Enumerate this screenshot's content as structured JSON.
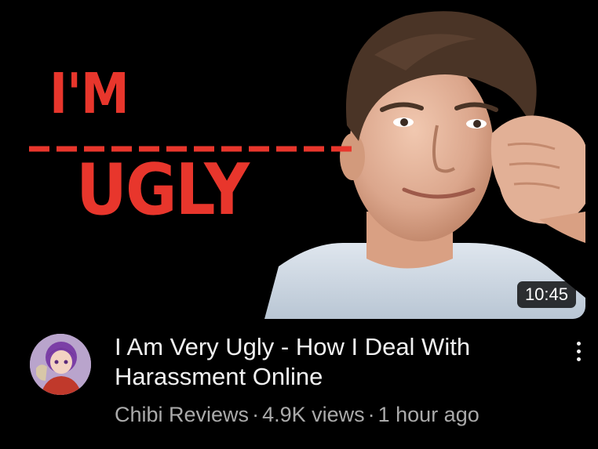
{
  "video": {
    "thumbnail": {
      "text_line1": "I'M",
      "text_line2": "UGLY",
      "accent_color": "#e8362c"
    },
    "duration": "10:45",
    "title": "I Am Very Ugly - How I Deal With Harassment Online",
    "channel": "Chibi Reviews",
    "separator": "·",
    "views": "4.9K views",
    "uploaded": "1 hour ago",
    "menu_icon": "more-vert-icon"
  }
}
